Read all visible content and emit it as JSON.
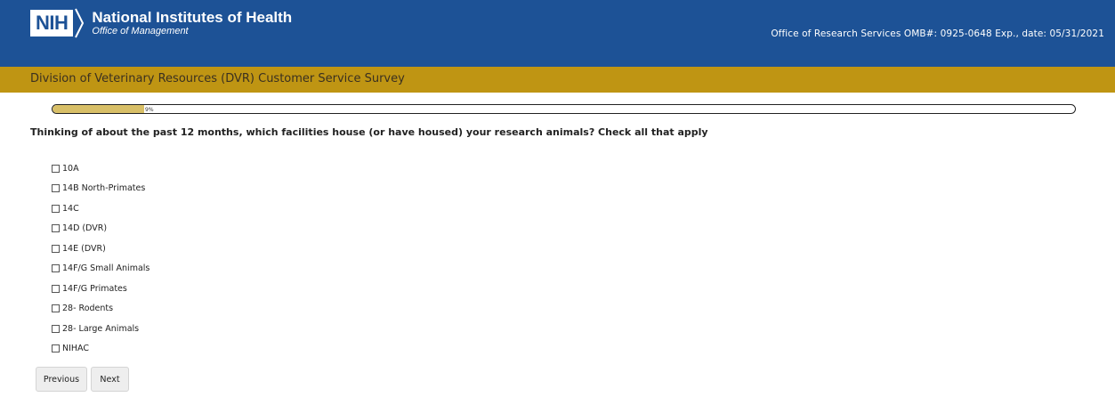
{
  "header": {
    "logo_text": "NIH",
    "org_name": "National Institutes of Health",
    "org_sub": "Office of Management",
    "omb_info": "Office of Research Services OMB#: 0925-0648 Exp., date: 05/31/2021"
  },
  "survey": {
    "title": "Division of Veterinary Resources (DVR) Customer Service Survey",
    "progress": {
      "percent": 9,
      "label": "9%"
    },
    "question": "Thinking of about the past 12 months, which facilities house (or have housed) your research animals? Check all that apply",
    "options": [
      "10A",
      "14B North-Primates",
      "14C",
      "14D (DVR)",
      "14E (DVR)",
      "14F/G Small Animals",
      "14F/G Primates",
      "28- Rodents",
      "28- Large Animals",
      "NIHAC"
    ]
  },
  "buttons": {
    "previous": "Previous",
    "next": "Next"
  },
  "colors": {
    "header_bg": "#1d5296",
    "subheader_bg": "#bf9513",
    "progress_fill": "#d8bf67"
  }
}
